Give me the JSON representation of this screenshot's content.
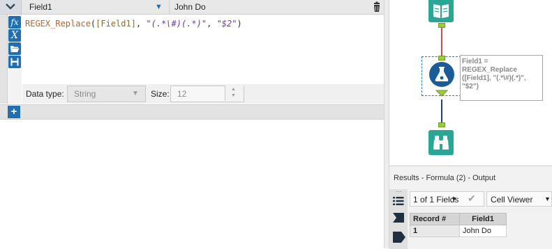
{
  "formula_editor": {
    "field_name": "Field1",
    "preview_value": "John Do",
    "expression": {
      "function": "REGEX_Replace",
      "open": "(",
      "field": "[Field1]",
      "sep1": ", ",
      "pattern": "\"(.*\\#)(.*)\"",
      "sep2": ", ",
      "replacement": "\"$2\"",
      "close": ")"
    },
    "tool_buttons": [
      "fx",
      "X",
      "open",
      "save"
    ],
    "data_type_label": "Data type:",
    "data_type_value": "String",
    "size_label": "Size:",
    "size_value": "12",
    "add_button": "+"
  },
  "canvas": {
    "annotation": "Field1 =\nREGEX_Replace\n([Field1], \"(.*\\#)(.*)\",\n\"$2\")"
  },
  "results": {
    "title": "Results - Formula (2) - Output",
    "fields_selector": "1 of 1 Fields",
    "viewer_selector": "Cell Viewer",
    "table": {
      "columns": [
        "Record #",
        "Field1"
      ],
      "rows": [
        [
          "1",
          "John Do"
        ]
      ]
    }
  },
  "colors": {
    "accent_blue": "#1f6fb2",
    "tool_teal": "#2aa794",
    "connector_green": "#9ccc3c",
    "wire_red": "#d24a4a",
    "wire_blue": "#233a9a"
  }
}
